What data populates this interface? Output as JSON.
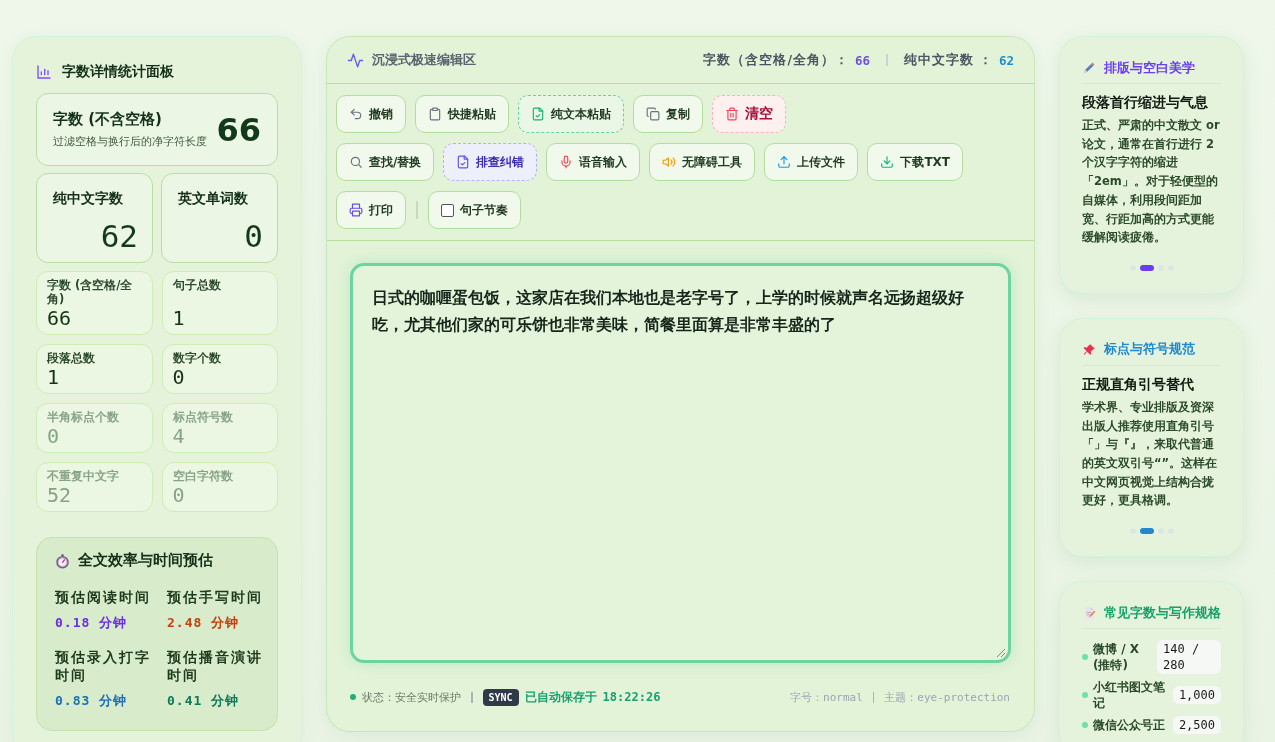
{
  "stats_panel": {
    "title": "字数详情统计面板",
    "primary": {
      "label": "字数 (不含空格)",
      "description": "过滤空格与换行后的净字符长度",
      "value": "66"
    },
    "highlights": [
      {
        "label": "纯中文字数",
        "value": "62"
      },
      {
        "label": "英文单词数",
        "value": "0"
      }
    ],
    "metrics": [
      {
        "label": "字数 (含空格/全角)",
        "value": "66",
        "dimmed": false
      },
      {
        "label": "句子总数",
        "value": "1",
        "dimmed": false
      },
      {
        "label": "段落总数",
        "value": "1",
        "dimmed": false
      },
      {
        "label": "数字个数",
        "value": "0",
        "dimmed": false
      },
      {
        "label": "半角标点个数",
        "value": "0",
        "dimmed": true
      },
      {
        "label": "标点符号数",
        "value": "4",
        "dimmed": true
      },
      {
        "label": "不重复中文字",
        "value": "52",
        "dimmed": true
      },
      {
        "label": "空白字符数",
        "value": "0",
        "dimmed": true
      }
    ],
    "estimates": {
      "title": "全文效率与时间预估",
      "items": [
        {
          "label": "预估阅读时间",
          "value": "0.18 分钟",
          "color": "#6a2ee8"
        },
        {
          "label": "预估手写时间",
          "value": "2.48 分钟",
          "color": "#c2410c"
        },
        {
          "label": "预估录入打字时间",
          "value": "0.83 分钟",
          "color": "#1d6fb8"
        },
        {
          "label": "预估播音演讲时间",
          "value": "0.41 分钟",
          "color": "#0f7a5a"
        }
      ]
    }
  },
  "editor": {
    "title": "沉浸式极速编辑区",
    "counters": [
      {
        "label": "字数（含空格/全角）：",
        "value": "66",
        "color": "#6d4fe0"
      },
      {
        "label": "纯中文字数 ：",
        "value": "62",
        "color": "#1a8fd6"
      }
    ],
    "toolbar": [
      [
        {
          "label": "撤销",
          "kind": "plain"
        },
        {
          "label": "快捷粘贴",
          "kind": "plain"
        },
        {
          "label": "纯文本粘贴",
          "kind": "success"
        },
        {
          "label": "复制",
          "kind": "plain"
        },
        {
          "label": "清空",
          "kind": "danger"
        }
      ],
      [
        {
          "label": "查找/替换",
          "kind": "plain"
        },
        {
          "label": "排查纠错",
          "kind": "accent"
        },
        {
          "label": "语音输入",
          "kind": "plain"
        },
        {
          "label": "无障碍工具",
          "kind": "plain"
        },
        {
          "label": "上传文件",
          "kind": "plain"
        },
        {
          "label": "下载TXT",
          "kind": "plain"
        }
      ],
      [
        {
          "label": "打印",
          "kind": "plain"
        },
        {
          "label": "句子节奏",
          "kind": "checkbox",
          "checked": false
        }
      ]
    ],
    "text": "日式的咖喱蛋包饭，这家店在我们本地也是老字号了，上学的时候就声名远扬超级好吃，尤其他们家的可乐饼也非常美味，简餐里面算是非常丰盛的了",
    "status": {
      "label": "状态：安全实时保护",
      "badge": "SYNC",
      "saved_label": "已自动保存于",
      "saved_time": "18:22:26",
      "font_size": "字号：normal",
      "theme": "主题：eye-protection"
    }
  },
  "tips": [
    {
      "title": "排版与空白美学",
      "color": "#6a3df0",
      "heading": "段落首行缩进与气息",
      "body": "正式、严肃的中文散文 or 论文，通常在首行进行 2 个汉字字符的缩进「2em」。对于轻便型的自媒体，利用段间距加宽、行距加高的方式更能缓解阅读疲倦。",
      "slides": [
        {
          "selected": false
        },
        {
          "selected": true
        },
        {
          "selected": false
        },
        {
          "selected": false
        }
      ]
    },
    {
      "title": "标点与符号规范",
      "color": "#1e88d0",
      "heading": "正规直角引号替代",
      "body": "学术界、专业排版及资深出版人推荐使用直角引号「」与『』，来取代普通的英文双引号“”。这样在中文网页视觉上结构合拢更好，更具格调。",
      "slides": [
        {
          "selected": false
        },
        {
          "selected": true
        },
        {
          "selected": false
        },
        {
          "selected": false
        }
      ]
    }
  ],
  "specs": {
    "title": "常见字数与写作规格",
    "rows": [
      {
        "label": "微博 / X (推特)",
        "value": "140 / 280"
      },
      {
        "label": "小红书图文笔记",
        "value": "1,000"
      },
      {
        "label": "微信公众号正",
        "value": "2,500"
      }
    ]
  }
}
